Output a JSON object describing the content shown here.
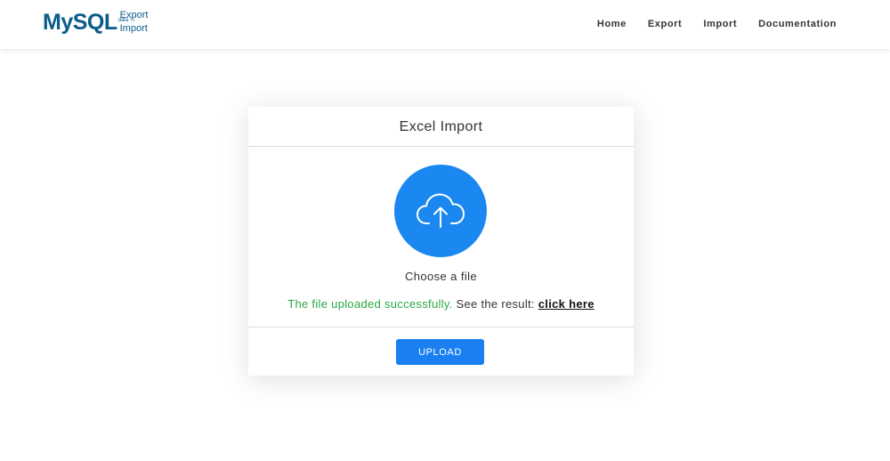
{
  "logo": {
    "main": "MySQL",
    "export": "Export",
    "data": "data",
    "arrows": "↑↓",
    "import": "Import"
  },
  "nav": {
    "items": [
      {
        "label": "Home"
      },
      {
        "label": "Export"
      },
      {
        "label": "Import"
      },
      {
        "label": "Documentation"
      }
    ]
  },
  "card": {
    "title": "Excel Import",
    "upload_icon": "cloud-upload-icon",
    "choose_file": "Choose a file",
    "status": {
      "success_text": "The file uploaded successfully.",
      "result_prefix": " See the result: ",
      "link_text": "click here"
    },
    "upload_button": "UPLOAD"
  },
  "colors": {
    "brand": "#0a5c8a",
    "accent": "#1a88f0",
    "success": "#28a745"
  }
}
